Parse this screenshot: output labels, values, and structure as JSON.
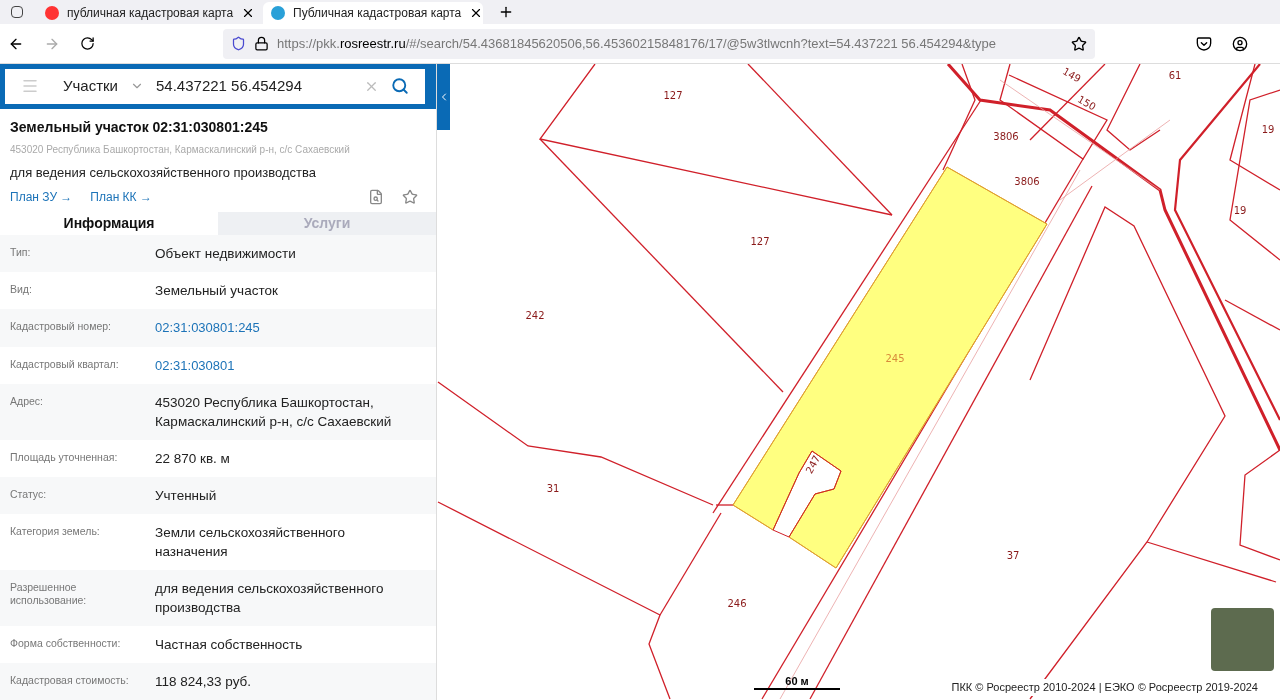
{
  "browser": {
    "tabs": [
      {
        "title": "публичная кадастровая карта",
        "selected": false
      },
      {
        "title": "Публичная кадастровая карта",
        "selected": true
      }
    ],
    "url": {
      "prefix": "https://pkk.",
      "domain": "rosreestr.ru",
      "rest": "/#/search/54.43681845620506,56.45360215848176/17/@5w3tlwcnh?text=54.437221 56.454294&type"
    }
  },
  "search": {
    "category": "Участки",
    "value": "54.437221 56.454294"
  },
  "card": {
    "title": "Земельный участок 02:31:030801:245",
    "address": "453020 Республика Башкортостан, Кармаскалинский р-н, с/с Сахаевский",
    "purpose": "для ведения сельскохозяйственного производства",
    "links": [
      "План ЗУ →",
      "План КК →"
    ]
  },
  "tabs": [
    {
      "label": "Информация",
      "selected": true
    },
    {
      "label": "Услуги",
      "selected": false
    }
  ],
  "info": [
    {
      "label": "Тип:",
      "value": "Объект недвижимости",
      "kind": "text"
    },
    {
      "label": "Вид:",
      "value": "Земельный участок",
      "kind": "text"
    },
    {
      "label": "Кадастровый номер:",
      "value": "02:31:030801:245",
      "kind": "link"
    },
    {
      "label": "Кадастровый квартал:",
      "value": "02:31:030801",
      "kind": "link"
    },
    {
      "label": "Адрес:",
      "value": "453020 Республика Башкортостан, Кармаскалинский р-н, с/с Сахаевский",
      "kind": "text"
    },
    {
      "label": "Площадь уточненная:",
      "value": "22 870 кв. м",
      "kind": "text"
    },
    {
      "label": "Статус:",
      "value": "Учтенный",
      "kind": "text"
    },
    {
      "label": "Категория земель:",
      "value": "Земли сельскохозяйственного назначения",
      "kind": "text"
    },
    {
      "label": "Разрешенное использование:",
      "value": "для ведения сельскохозяйственного производства",
      "kind": "text"
    },
    {
      "label": "Форма собственности:",
      "value": "Частная собственность",
      "kind": "text"
    },
    {
      "label": "Кадастровая стоимость:",
      "value": "118 824,33 руб.",
      "kind": "text"
    }
  ],
  "map": {
    "parcels": [
      {
        "number": "127",
        "selected": false
      },
      {
        "number": "3806",
        "selected": false
      },
      {
        "number": "3806",
        "selected": false
      },
      {
        "number": "127",
        "selected": false
      },
      {
        "number": "242",
        "selected": false
      },
      {
        "number": "245",
        "selected": true
      },
      {
        "number": "247",
        "selected": false
      },
      {
        "number": "31",
        "selected": false
      },
      {
        "number": "37",
        "selected": false
      },
      {
        "number": "246",
        "selected": false
      },
      {
        "number": "149",
        "selected": false
      },
      {
        "number": "150",
        "selected": false
      },
      {
        "number": "61",
        "selected": false
      },
      {
        "number": "19",
        "selected": false
      },
      {
        "number": "19",
        "selected": false
      }
    ],
    "scale": "60 м",
    "copyright": "ПКК © Росреестр 2010-2024 | ЕЭКО © Росреестр 2019-2024"
  }
}
